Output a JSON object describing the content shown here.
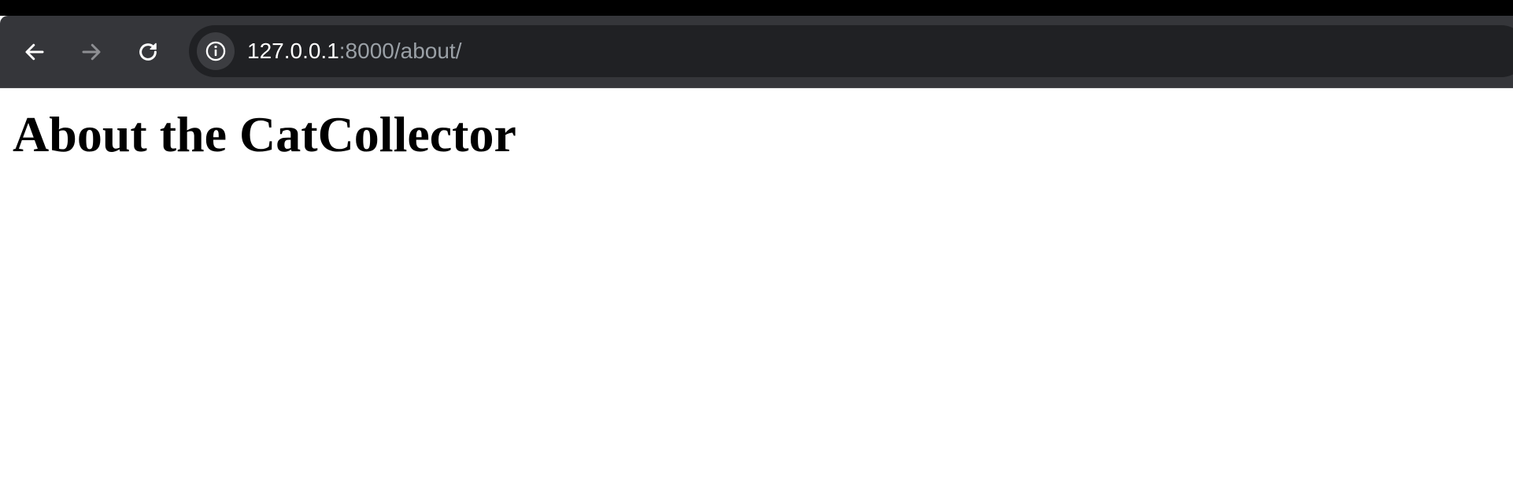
{
  "browser": {
    "address_bar": {
      "host": "127.0.0.1",
      "rest": ":8000/about/"
    },
    "icons": {
      "back": "arrow-left-icon",
      "forward": "arrow-right-icon",
      "reload": "reload-icon",
      "site_info": "info-icon"
    },
    "forward_enabled": false
  },
  "page": {
    "heading": "About the CatCollector"
  },
  "colors": {
    "toolbar": "#35363a",
    "omnibox": "#202124",
    "url_host": "#ffffff",
    "url_rest": "#9aa0a6",
    "page_background": "#ffffff"
  }
}
